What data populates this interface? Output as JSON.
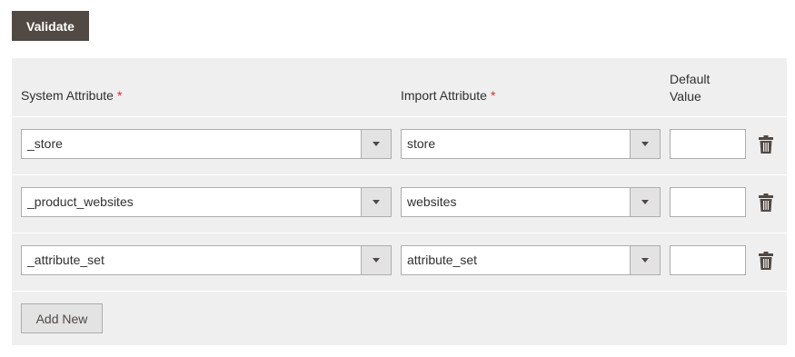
{
  "toolbar": {
    "validate_label": "Validate"
  },
  "table": {
    "headers": {
      "system_attribute": "System Attribute",
      "import_attribute": "Import Attribute",
      "default_value": "Default Value",
      "required_marker": "*"
    },
    "rows": [
      {
        "system_attribute": "_store",
        "import_attribute": "store",
        "default_value": ""
      },
      {
        "system_attribute": "_product_websites",
        "import_attribute": "websites",
        "default_value": ""
      },
      {
        "system_attribute": "_attribute_set",
        "import_attribute": "attribute_set",
        "default_value": ""
      }
    ]
  },
  "footer": {
    "add_new_label": "Add New"
  },
  "icons": {
    "dropdown": "chevron-down-icon",
    "delete": "trash-icon"
  },
  "colors": {
    "primary_button_bg": "#514943",
    "panel_bg": "#efefef",
    "required_marker": "#e22626",
    "secondary_button_bg": "#e3e3e3"
  }
}
